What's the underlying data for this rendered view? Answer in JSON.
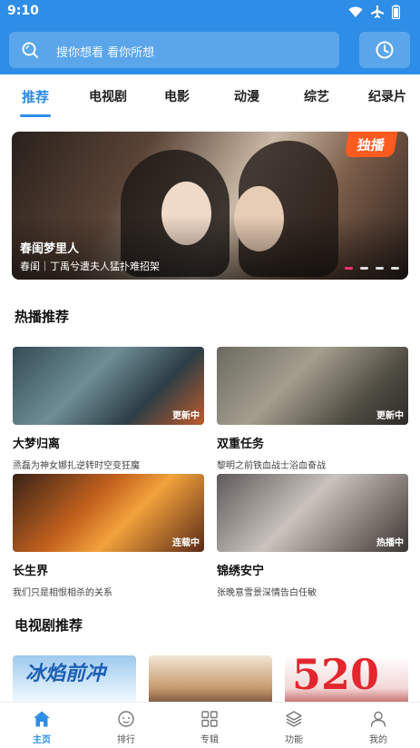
{
  "status_bar": {
    "time": "9:10",
    "icons": [
      "wifi-icon",
      "airplane-icon",
      "battery-icon"
    ]
  },
  "search": {
    "placeholder": "搜你想看 看你所想",
    "icon": "search-icon"
  },
  "history_button": {
    "icon": "clock-icon"
  },
  "tabs": [
    {
      "label": "推荐",
      "active": true
    },
    {
      "label": "电视剧"
    },
    {
      "label": "电影"
    },
    {
      "label": "动漫"
    },
    {
      "label": "综艺"
    },
    {
      "label": "纪录片"
    }
  ],
  "banner": {
    "badge": "独播",
    "title": "春闺梦里人",
    "subtitle": "春闺｜丁禹兮遭夫人猛扑难招架",
    "dots": 4,
    "active_dot": 0
  },
  "hot_section": {
    "title": "热播推荐",
    "cards": [
      {
        "name": "大梦归离",
        "desc": "烝磊为神女娜扎逆转时空变狂魔",
        "badge": "更新中"
      },
      {
        "name": "双重任务",
        "desc": "黎明之前铁血战士浴血奋战",
        "badge": "更新中"
      },
      {
        "name": "长生界",
        "desc": "我们只是相恨相杀的关系",
        "badge": "连载中"
      },
      {
        "name": "锦绣安宁",
        "desc": "张晚意雪景深情告白任敏",
        "badge": "热播中"
      }
    ]
  },
  "tv_section": {
    "title": "电视剧推荐",
    "posters": [
      {
        "text": "冰焰前冲"
      },
      {
        "text": ""
      },
      {
        "text": "520"
      }
    ]
  },
  "bottom_nav": [
    {
      "label": "主页",
      "icon": "home-icon",
      "active": true
    },
    {
      "label": "排行",
      "icon": "ranking-icon"
    },
    {
      "label": "专辑",
      "icon": "grid-icon"
    },
    {
      "label": "功能",
      "icon": "layers-icon"
    },
    {
      "label": "我的",
      "icon": "user-icon"
    }
  ],
  "colors": {
    "accent": "#2e8de6",
    "header": "#2e8de6",
    "badge_exclusive": "#ff5a1f",
    "dot_active": "#ff2e73"
  }
}
